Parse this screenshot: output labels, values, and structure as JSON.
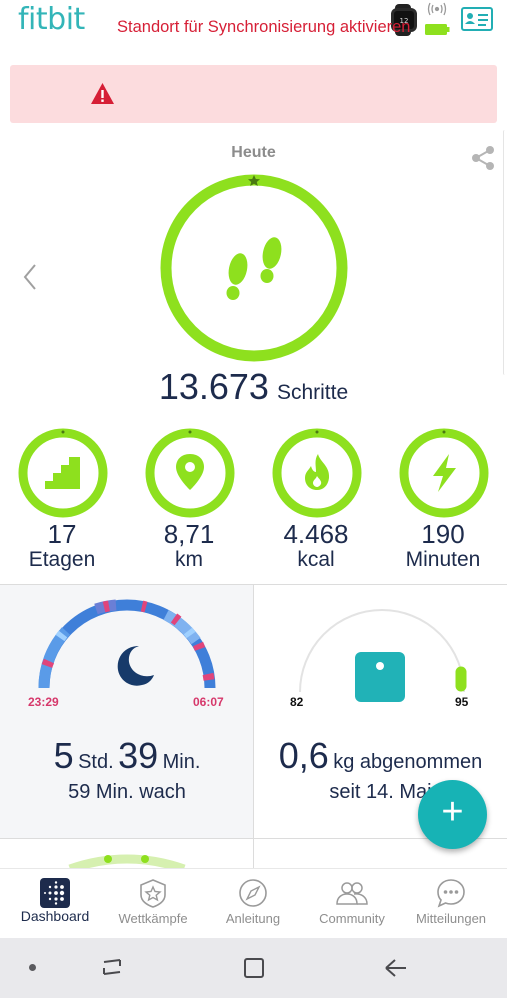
{
  "header": {
    "logo_text": "fitbit",
    "icons": [
      "watch-icon",
      "battery-icon",
      "signal-icon",
      "profile-card-icon"
    ]
  },
  "banner": {
    "text": "Standort für Synchronisierung aktivieren",
    "icon": "warning-icon",
    "color": "#d61f36",
    "background": "#fcdcde"
  },
  "today": {
    "label": "Heute",
    "steps_value": "13.673",
    "steps_unit": "Schritte",
    "steps_goal_progress": 1.0,
    "accent_color": "#8ee01e"
  },
  "stats": [
    {
      "icon": "stairs-icon",
      "value": "17",
      "unit": "Etagen"
    },
    {
      "icon": "location-pin-icon",
      "value": "8,71",
      "unit": "km"
    },
    {
      "icon": "flame-icon",
      "value": "4.468",
      "unit": "kcal"
    },
    {
      "icon": "lightning-icon",
      "value": "190",
      "unit": "Minuten"
    }
  ],
  "sleep": {
    "start_time": "23:29",
    "end_time": "06:07",
    "hours": "5",
    "hours_unit": "Std.",
    "minutes": "39",
    "minutes_unit": "Min.",
    "awake": "59 Min. wach",
    "icon": "moon-icon"
  },
  "weight": {
    "start": "82",
    "end": "95",
    "value": "0,6",
    "label": "kg abgenommen",
    "since": "seit 14. Mai",
    "icon": "scale-icon"
  },
  "fab": {
    "label": "+"
  },
  "bottom_nav": [
    {
      "label": "Dashboard",
      "icon": "dashboard-icon",
      "active": true
    },
    {
      "label": "Wettkämpfe",
      "icon": "badge-star-icon",
      "active": false
    },
    {
      "label": "Anleitung",
      "icon": "compass-icon",
      "active": false
    },
    {
      "label": "Community",
      "icon": "community-icon",
      "active": false
    },
    {
      "label": "Mitteilungen",
      "icon": "chat-bubble-icon",
      "active": false
    }
  ]
}
